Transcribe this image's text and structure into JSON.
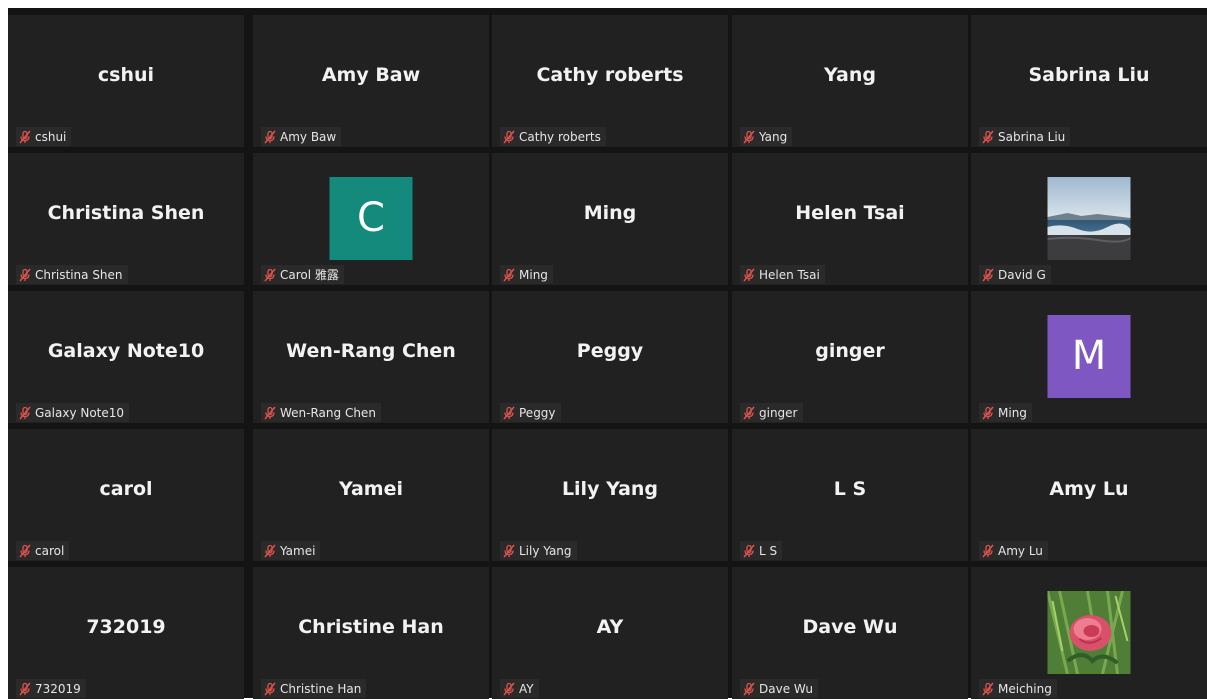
{
  "colors": {
    "tile_bg": "#212121",
    "grid_bg": "#141414",
    "muted_mic": "#e0524a",
    "avatar_teal": "#138a7b",
    "avatar_purple": "#7e57c2"
  },
  "participants": [
    {
      "display": "cshui",
      "tag": "cshui",
      "muted": true
    },
    {
      "display": "Amy Baw",
      "tag": "Amy Baw",
      "muted": true
    },
    {
      "display": "Cathy roberts",
      "tag": "Cathy roberts",
      "muted": true
    },
    {
      "display": "Yang",
      "tag": "Yang",
      "muted": true
    },
    {
      "display": "Sabrina Liu",
      "tag": "Sabrina Liu",
      "muted": true
    },
    {
      "display": "Christina Shen",
      "tag": "Christina Shen",
      "muted": true
    },
    {
      "avatar_letter": "C",
      "avatar_color": "#138a7b",
      "tag": "Carol 雅露",
      "muted": true
    },
    {
      "display": "Ming",
      "tag": "Ming",
      "muted": true
    },
    {
      "display": "Helen Tsai",
      "tag": "Helen Tsai",
      "muted": true
    },
    {
      "photo": "beach-photo",
      "tag": "David G",
      "muted": true
    },
    {
      "display": "Galaxy Note10",
      "tag": "Galaxy Note10",
      "muted": true
    },
    {
      "display": "Wen-Rang Chen",
      "tag": "Wen-Rang Chen",
      "muted": true
    },
    {
      "display": "Peggy",
      "tag": "Peggy",
      "muted": true
    },
    {
      "display": "ginger",
      "tag": "ginger",
      "muted": true
    },
    {
      "avatar_letter": "M",
      "avatar_color": "#7e57c2",
      "tag": "Ming",
      "muted": true
    },
    {
      "display": "carol",
      "tag": "carol",
      "muted": true
    },
    {
      "display": "Yamei",
      "tag": "Yamei",
      "muted": true
    },
    {
      "display": "Lily Yang",
      "tag": "Lily Yang",
      "muted": true
    },
    {
      "display": "L S",
      "tag": "L S",
      "muted": true
    },
    {
      "display": "Amy Lu",
      "tag": "Amy Lu",
      "muted": true
    },
    {
      "display": "732019",
      "tag": "732019",
      "muted": true
    },
    {
      "display": "Christine Han",
      "tag": "Christine Han",
      "muted": true
    },
    {
      "display": "AY",
      "tag": "AY",
      "muted": true
    },
    {
      "display": "Dave Wu",
      "tag": "Dave Wu",
      "muted": true
    },
    {
      "photo": "flower-photo",
      "tag": "Meiching",
      "muted": true
    }
  ]
}
